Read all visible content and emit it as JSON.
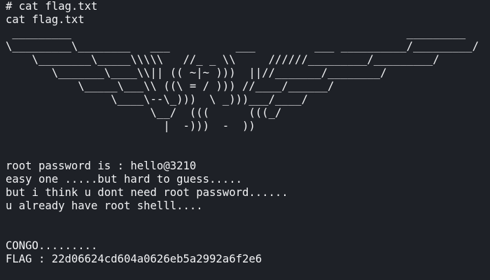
{
  "terminal": {
    "prompt_line": "# cat flag.txt",
    "echo_line": "cat flag.txt",
    "ascii_art": " _________                                                   _________\n\\_________\\________   ___          ___         ___ __________/_________/\n    \\________\\_____\\\\\\\\\\   //_ _ \\\\     //////_________/_________/\n       \\_______\\____\\\\|| (( ~|~ )))  ||//_______/________/\n           \\_____\\___\\\\ ((\\ = / ))) //____/______/\n                \\____\\--\\_)))  \\ _)))___/____/\n                      \\__/  (((      (((_/\n                        |  -)))  -  ))",
    "messages": [
      "root password is : hello@3210",
      "easy one .....but hard to guess.....",
      "but i think u dont need root password......",
      "u already have root shelll...."
    ],
    "congo": "CONGO.........",
    "flag_line": "FLAG : 22d06624cd604a0626eb5a2992a6f2e6"
  },
  "colors": {
    "background": "#1e2127",
    "foreground": "#f2f3f5"
  }
}
